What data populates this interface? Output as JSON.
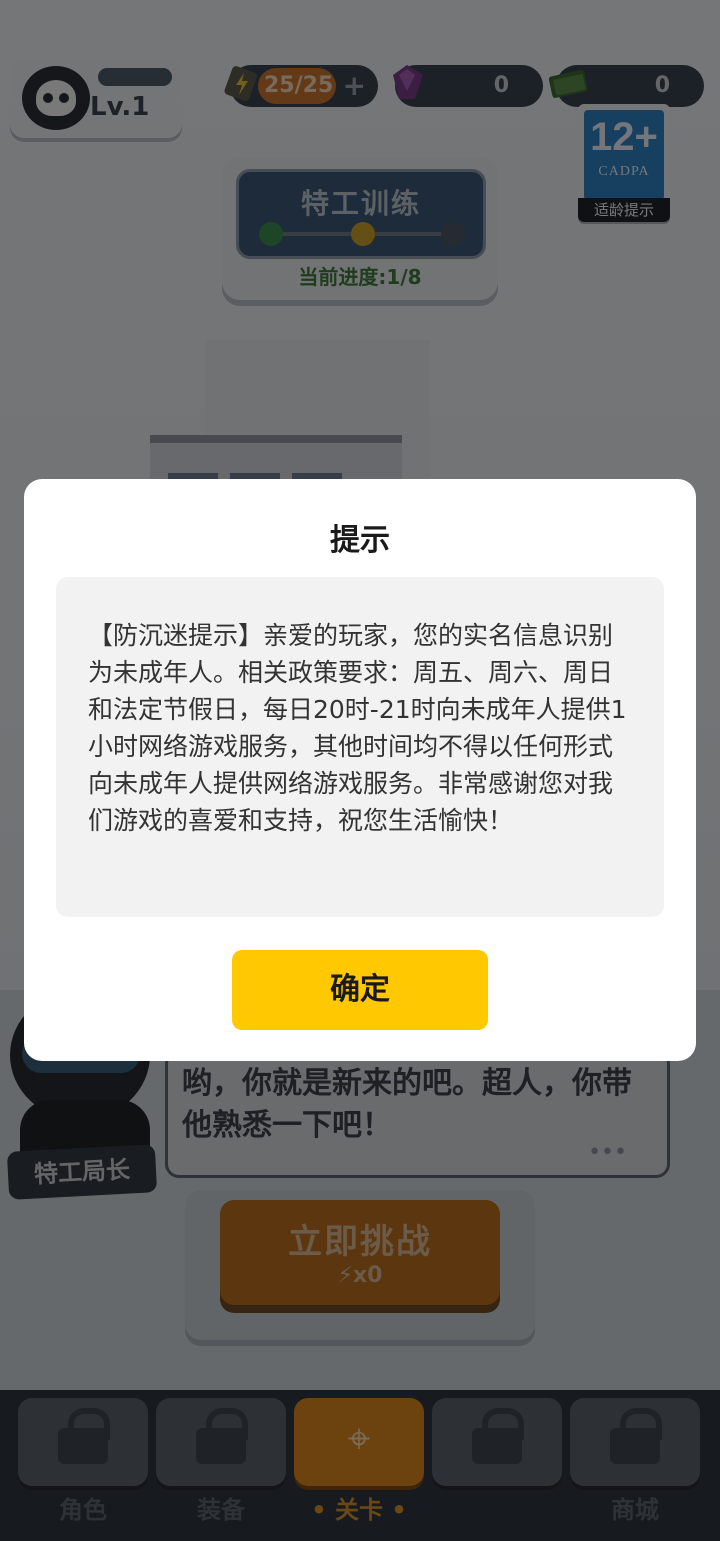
{
  "hud": {
    "level": "Lv.1",
    "energy": "25/25",
    "energy_plus": "+",
    "gems": "0",
    "cash": "0",
    "age_rating": "12+",
    "age_org": "CADPA",
    "age_tip": "适龄提示"
  },
  "training": {
    "title": "特工训练",
    "progress": "当前进度:1/8",
    "progress_current": 1,
    "progress_total": 8
  },
  "dialogue": {
    "speaker": "特工局长",
    "text": "哟，你就是新来的吧。超人，你带他熟悉一下吧！",
    "more": "•••"
  },
  "challenge": {
    "label": "立即挑战",
    "cost": "x0"
  },
  "nav": {
    "tabs": [
      {
        "label": "角色",
        "icon": "lock-icon"
      },
      {
        "label": "装备",
        "icon": "lock-icon"
      },
      {
        "label": "• 关卡 •",
        "icon": "map-pin-icon"
      },
      {
        "label": "",
        "icon": "lock-icon"
      },
      {
        "label": "商城",
        "icon": "lock-icon"
      }
    ]
  },
  "modal": {
    "title": "提示",
    "message": "【防沉迷提示】亲爱的玩家，您的实名信息识别为未成年人。相关政策要求：周五、周六、周日和法定节假日，每日20时-21时向未成年人提供1小时网络游戏服务，其他时间均不得以任何形式向未成年人提供网络游戏服务。非常感谢您对我们游戏的喜爱和支持，祝您生活愉快！",
    "confirm": "确定"
  },
  "colors": {
    "confirm_button": "#ffc800",
    "overlay": "rgba(0,0,0,0.5)",
    "active_tab": "#d9841c"
  }
}
